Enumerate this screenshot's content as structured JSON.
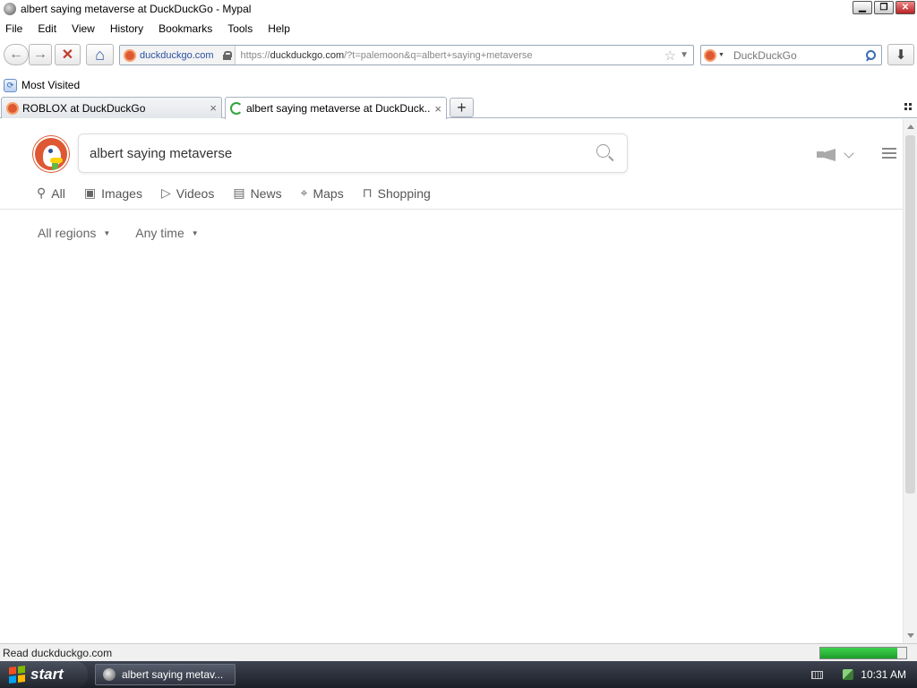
{
  "window": {
    "title": "albert saying metaverse at DuckDuckGo - Mypal",
    "controls": {
      "minimize": "▁",
      "maximize": "❐",
      "close": "✕"
    }
  },
  "menu": [
    "File",
    "Edit",
    "View",
    "History",
    "Bookmarks",
    "Tools",
    "Help"
  ],
  "navbar": {
    "back": "←",
    "forward": "→",
    "stop": "✕",
    "home": "⌂",
    "identity_label": "duckduckgo.com",
    "url_prefix": "https://",
    "url_host": "duckduckgo.com",
    "url_rest": "/?t=palemoon&q=albert+saying+metaverse",
    "star": "☆",
    "dropdown": "▼",
    "search_engine_placeholder": "DuckDuckGo",
    "search_engine_arrow": "▼",
    "download": "⬇"
  },
  "bookmarks_bar": {
    "most_visited": "Most Visited",
    "icon_glyph": "⟳"
  },
  "tabs": [
    {
      "label": "ROBLOX at DuckDuckGo",
      "close": "×",
      "active": false
    },
    {
      "label": "albert saying metaverse at DuckDuck...",
      "close": "×",
      "active": true
    }
  ],
  "new_tab": "+",
  "page": {
    "query": "albert saying metaverse",
    "verticals": [
      {
        "label": "All",
        "icon": "⚲"
      },
      {
        "label": "Images",
        "icon": "▣"
      },
      {
        "label": "Videos",
        "icon": "▷"
      },
      {
        "label": "News",
        "icon": "▤"
      },
      {
        "label": "Maps",
        "icon": "⌖"
      },
      {
        "label": "Shopping",
        "icon": "⊓"
      }
    ],
    "filters": [
      {
        "label": "All regions",
        "caret": "▼"
      },
      {
        "label": "Any time",
        "caret": "▼"
      }
    ]
  },
  "status": {
    "text": "Read duckduckgo.com",
    "progress": 0.9
  },
  "taskbar": {
    "start_label": "start",
    "task_label": "albert saying metav...",
    "clock": "10:31 AM"
  },
  "colors": {
    "ddg_orange": "#de5833",
    "progress_green": "#1c9e2a"
  }
}
